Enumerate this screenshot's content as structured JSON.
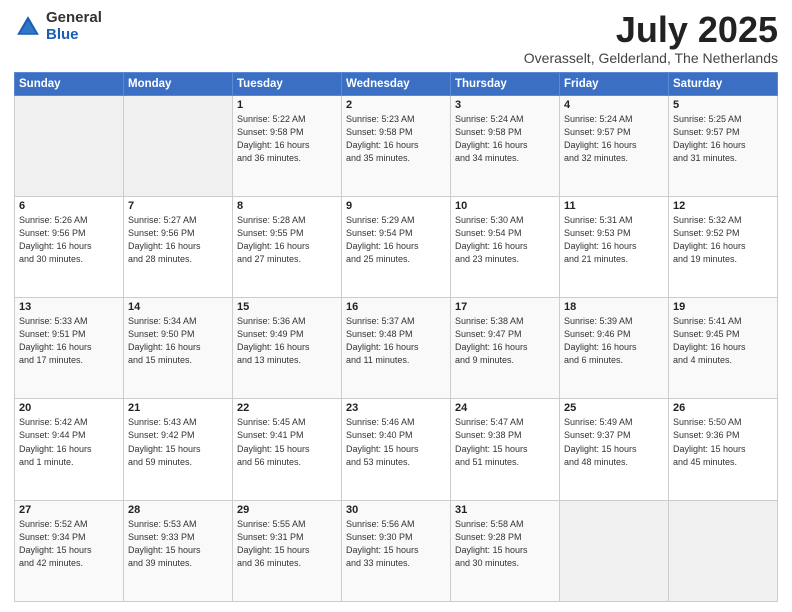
{
  "logo": {
    "general": "General",
    "blue": "Blue"
  },
  "header": {
    "month": "July 2025",
    "location": "Overasselt, Gelderland, The Netherlands"
  },
  "weekdays": [
    "Sunday",
    "Monday",
    "Tuesday",
    "Wednesday",
    "Thursday",
    "Friday",
    "Saturday"
  ],
  "weeks": [
    [
      {
        "num": "",
        "info": ""
      },
      {
        "num": "",
        "info": ""
      },
      {
        "num": "1",
        "info": "Sunrise: 5:22 AM\nSunset: 9:58 PM\nDaylight: 16 hours\nand 36 minutes."
      },
      {
        "num": "2",
        "info": "Sunrise: 5:23 AM\nSunset: 9:58 PM\nDaylight: 16 hours\nand 35 minutes."
      },
      {
        "num": "3",
        "info": "Sunrise: 5:24 AM\nSunset: 9:58 PM\nDaylight: 16 hours\nand 34 minutes."
      },
      {
        "num": "4",
        "info": "Sunrise: 5:24 AM\nSunset: 9:57 PM\nDaylight: 16 hours\nand 32 minutes."
      },
      {
        "num": "5",
        "info": "Sunrise: 5:25 AM\nSunset: 9:57 PM\nDaylight: 16 hours\nand 31 minutes."
      }
    ],
    [
      {
        "num": "6",
        "info": "Sunrise: 5:26 AM\nSunset: 9:56 PM\nDaylight: 16 hours\nand 30 minutes."
      },
      {
        "num": "7",
        "info": "Sunrise: 5:27 AM\nSunset: 9:56 PM\nDaylight: 16 hours\nand 28 minutes."
      },
      {
        "num": "8",
        "info": "Sunrise: 5:28 AM\nSunset: 9:55 PM\nDaylight: 16 hours\nand 27 minutes."
      },
      {
        "num": "9",
        "info": "Sunrise: 5:29 AM\nSunset: 9:54 PM\nDaylight: 16 hours\nand 25 minutes."
      },
      {
        "num": "10",
        "info": "Sunrise: 5:30 AM\nSunset: 9:54 PM\nDaylight: 16 hours\nand 23 minutes."
      },
      {
        "num": "11",
        "info": "Sunrise: 5:31 AM\nSunset: 9:53 PM\nDaylight: 16 hours\nand 21 minutes."
      },
      {
        "num": "12",
        "info": "Sunrise: 5:32 AM\nSunset: 9:52 PM\nDaylight: 16 hours\nand 19 minutes."
      }
    ],
    [
      {
        "num": "13",
        "info": "Sunrise: 5:33 AM\nSunset: 9:51 PM\nDaylight: 16 hours\nand 17 minutes."
      },
      {
        "num": "14",
        "info": "Sunrise: 5:34 AM\nSunset: 9:50 PM\nDaylight: 16 hours\nand 15 minutes."
      },
      {
        "num": "15",
        "info": "Sunrise: 5:36 AM\nSunset: 9:49 PM\nDaylight: 16 hours\nand 13 minutes."
      },
      {
        "num": "16",
        "info": "Sunrise: 5:37 AM\nSunset: 9:48 PM\nDaylight: 16 hours\nand 11 minutes."
      },
      {
        "num": "17",
        "info": "Sunrise: 5:38 AM\nSunset: 9:47 PM\nDaylight: 16 hours\nand 9 minutes."
      },
      {
        "num": "18",
        "info": "Sunrise: 5:39 AM\nSunset: 9:46 PM\nDaylight: 16 hours\nand 6 minutes."
      },
      {
        "num": "19",
        "info": "Sunrise: 5:41 AM\nSunset: 9:45 PM\nDaylight: 16 hours\nand 4 minutes."
      }
    ],
    [
      {
        "num": "20",
        "info": "Sunrise: 5:42 AM\nSunset: 9:44 PM\nDaylight: 16 hours\nand 1 minute."
      },
      {
        "num": "21",
        "info": "Sunrise: 5:43 AM\nSunset: 9:42 PM\nDaylight: 15 hours\nand 59 minutes."
      },
      {
        "num": "22",
        "info": "Sunrise: 5:45 AM\nSunset: 9:41 PM\nDaylight: 15 hours\nand 56 minutes."
      },
      {
        "num": "23",
        "info": "Sunrise: 5:46 AM\nSunset: 9:40 PM\nDaylight: 15 hours\nand 53 minutes."
      },
      {
        "num": "24",
        "info": "Sunrise: 5:47 AM\nSunset: 9:38 PM\nDaylight: 15 hours\nand 51 minutes."
      },
      {
        "num": "25",
        "info": "Sunrise: 5:49 AM\nSunset: 9:37 PM\nDaylight: 15 hours\nand 48 minutes."
      },
      {
        "num": "26",
        "info": "Sunrise: 5:50 AM\nSunset: 9:36 PM\nDaylight: 15 hours\nand 45 minutes."
      }
    ],
    [
      {
        "num": "27",
        "info": "Sunrise: 5:52 AM\nSunset: 9:34 PM\nDaylight: 15 hours\nand 42 minutes."
      },
      {
        "num": "28",
        "info": "Sunrise: 5:53 AM\nSunset: 9:33 PM\nDaylight: 15 hours\nand 39 minutes."
      },
      {
        "num": "29",
        "info": "Sunrise: 5:55 AM\nSunset: 9:31 PM\nDaylight: 15 hours\nand 36 minutes."
      },
      {
        "num": "30",
        "info": "Sunrise: 5:56 AM\nSunset: 9:30 PM\nDaylight: 15 hours\nand 33 minutes."
      },
      {
        "num": "31",
        "info": "Sunrise: 5:58 AM\nSunset: 9:28 PM\nDaylight: 15 hours\nand 30 minutes."
      },
      {
        "num": "",
        "info": ""
      },
      {
        "num": "",
        "info": ""
      }
    ]
  ]
}
